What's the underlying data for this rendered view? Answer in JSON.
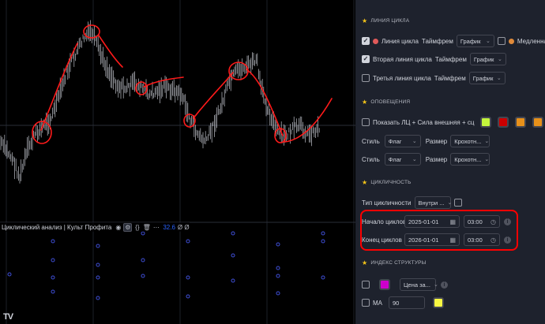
{
  "chart": {
    "indicator_title": "Циклический анализ | Культ Профита",
    "indicator_value": "32.6",
    "indicator_values_tail": "Ø Ø",
    "logo": "TV",
    "bar_color": "#e0e3eb",
    "annotation_color": "#ff1a1a",
    "osc_dot_color": "#3f4fd8",
    "icons": [
      "eye-icon",
      "settings-icon",
      "source-code-icon",
      "delete-icon",
      "more-icon"
    ]
  },
  "settings": {
    "cycle_line": {
      "section_title": "ЛИНИЯ ЦИКЛА",
      "line1": {
        "enabled": true,
        "label": "Линия цикла",
        "dot_color": "#e05a5a",
        "tf_label": "Таймфрем",
        "tf_value": "График",
        "slow_enabled": false,
        "slow_label": "Медленная",
        "slow_dot_color": "#e08a3a"
      },
      "line2": {
        "enabled": true,
        "label": "Вторая линия цикла",
        "tf_label": "Таймфрем",
        "tf_value": "График"
      },
      "line3": {
        "enabled": false,
        "label": "Третья линия цикла",
        "tf_label": "Таймфрем",
        "tf_value": "График"
      }
    },
    "alerts": {
      "section_title": "ОПОВЕЩЕНИЯ",
      "show": {
        "enabled": false,
        "label": "Показать ЛЦ + Сила внешняя + сц",
        "colors": [
          "#c3f53c",
          "#cc0000",
          "#e8911a",
          "#e8911a"
        ]
      },
      "style1": {
        "style_label": "Стиль",
        "style_value": "Флаг",
        "size_label": "Размер",
        "size_value": "Крохотн..."
      },
      "style2": {
        "style_label": "Стиль",
        "style_value": "Флаг",
        "size_label": "Размер",
        "size_value": "Крохотн..."
      }
    },
    "cyclicity": {
      "section_title": "ЦИКЛИЧНОСТЬ",
      "type_label": "Тип цикличности",
      "type_value": "Внутри ...",
      "type_checkbox": false,
      "start_label": "Начало циклов",
      "start_date": "2025-01-01",
      "start_time": "03:00",
      "end_label": "Конец циклов",
      "end_date": "2026-01-01",
      "end_time": "03:00"
    },
    "structure": {
      "section_title": "ИНДЕКС СТРУКТУРЫ",
      "row1": {
        "enabled": false,
        "color": "#cc00cc",
        "select_value": "Цена за..."
      },
      "ma": {
        "enabled": false,
        "label": "MA",
        "value": "90",
        "color": "#f7f742"
      }
    }
  }
}
